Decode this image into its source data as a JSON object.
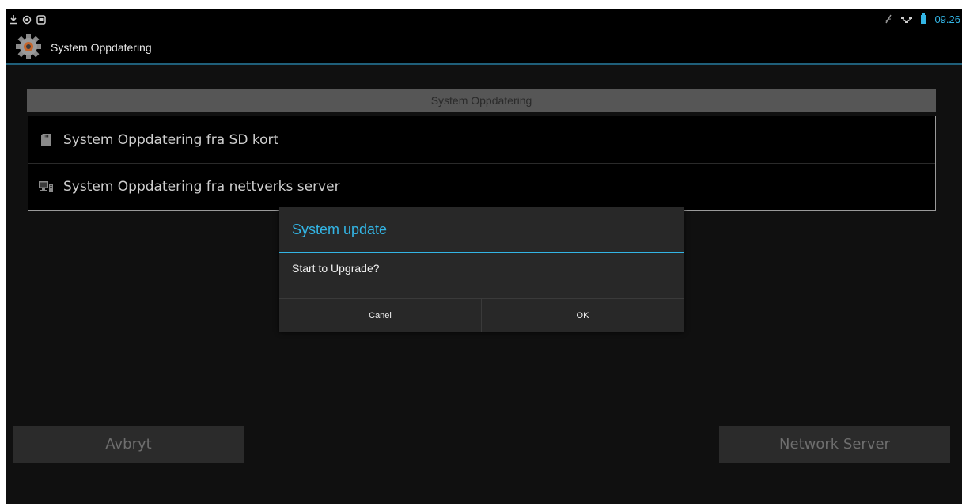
{
  "status_bar": {
    "left_icons": [
      "download-icon",
      "eye-icon",
      "screen-icon"
    ],
    "right_icons": [
      "signal-off-icon",
      "network-icon",
      "battery-icon"
    ],
    "time": "09.26"
  },
  "action_bar": {
    "icon": "settings-gear-icon",
    "title": "System Oppdatering"
  },
  "section": {
    "header": "System Oppdatering",
    "options": [
      {
        "label": "System Oppdatering fra SD kort",
        "icon": "sd-card-icon"
      },
      {
        "label": "System Oppdatering fra nettverks server",
        "icon": "network-server-icon"
      }
    ]
  },
  "buttons": {
    "cancel": "Avbryt",
    "network": "Network Server"
  },
  "dialog": {
    "title": "System update",
    "message": "Start to Upgrade?",
    "negative": "Canel",
    "positive": "OK"
  },
  "colors": {
    "accent": "#33b5e5",
    "background": "#101010"
  }
}
